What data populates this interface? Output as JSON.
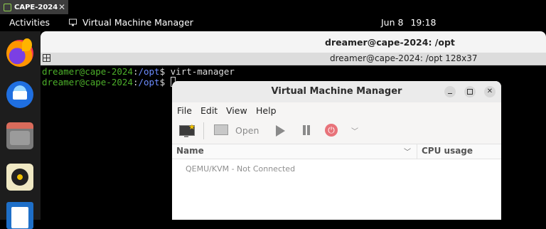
{
  "host_tab": {
    "label": "CAPE-2024",
    "close": "✕"
  },
  "topbar": {
    "activities": "Activities",
    "app_name": "Virtual Machine Manager",
    "date": "Jun 8",
    "time": "19:18"
  },
  "dock": {
    "items": [
      "firefox-icon",
      "thunderbird-icon",
      "files-icon",
      "rhythmbox-icon",
      "libreoffice-writer-icon"
    ]
  },
  "terminal": {
    "title": "dreamer@cape-2024: /opt",
    "tab_title": "dreamer@cape-2024: /opt 128x37",
    "lines": [
      {
        "user_host": "dreamer@cape-2024",
        "sep": ":",
        "path": "/opt",
        "prompt": "$ ",
        "command": "virt-manager"
      },
      {
        "user_host": "dreamer@cape-2024",
        "sep": ":",
        "path": "/opt",
        "prompt": "$ ",
        "command": ""
      }
    ]
  },
  "vmm": {
    "title": "Virtual Machine Manager",
    "menu": {
      "file": "File",
      "edit": "Edit",
      "view": "View",
      "help": "Help"
    },
    "toolbar": {
      "open_label": "Open"
    },
    "columns": {
      "name": "Name",
      "cpu": "CPU usage"
    },
    "connections": [
      "QEMU/KVM - Not Connected"
    ],
    "colors": {
      "power": "#e8737a",
      "prompt_user": "#4caf2a",
      "prompt_path": "#6c8cff"
    }
  }
}
